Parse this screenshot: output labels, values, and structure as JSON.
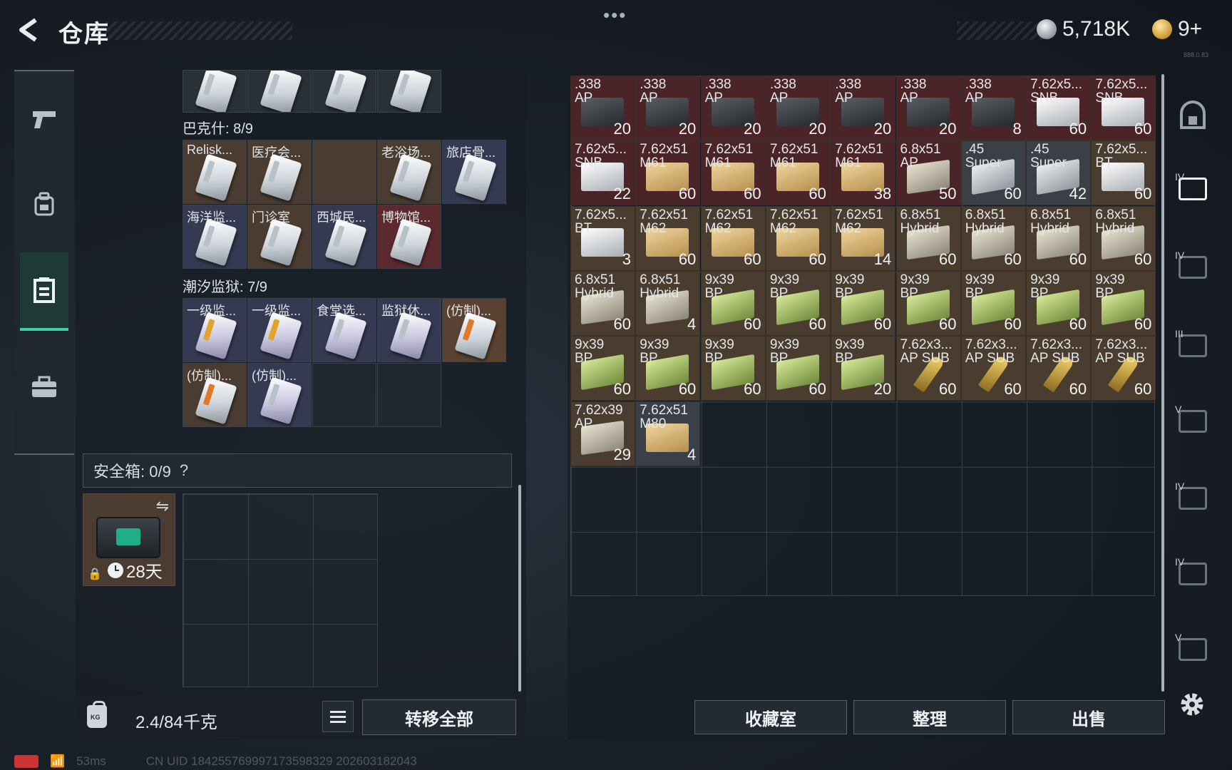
{
  "header": {
    "title": "仓库",
    "more": "•••",
    "currency_silver": "5,718K",
    "currency_gold": "9+",
    "version": "888.0.83"
  },
  "left": {
    "section1_title": "巴克什: 8/9",
    "section1_items": [
      "Relisk...",
      "医疗会...",
      "",
      "老浴场...",
      "旅店骨...",
      "海洋监...",
      "门诊室",
      "西城民...",
      "博物馆..."
    ],
    "section2_title": "潮汐监狱: 7/9",
    "section2_items": [
      "一级监...",
      "一级监...",
      "食堂选...",
      "监狱休...",
      "(仿制)...",
      "(仿制)...",
      "(仿制)..."
    ],
    "safe_title": "安全箱: 0/9",
    "safe_help": "?",
    "safe_timer": "28天",
    "weight": "2.4/84千克",
    "transfer_all": "转移全部"
  },
  "grid": {
    "rows": [
      [
        {
          "n": ".338\nAP",
          "c": "20",
          "t": "red",
          "p": "black"
        },
        {
          "n": ".338\nAP",
          "c": "20",
          "t": "red",
          "p": "black"
        },
        {
          "n": ".338\nAP",
          "c": "20",
          "t": "red",
          "p": "black"
        },
        {
          "n": ".338\nAP",
          "c": "20",
          "t": "red",
          "p": "black"
        },
        {
          "n": ".338\nAP",
          "c": "20",
          "t": "red",
          "p": "black"
        },
        {
          "n": ".338\nAP",
          "c": "20",
          "t": "red",
          "p": "black"
        },
        {
          "n": ".338\nAP",
          "c": "8",
          "t": "red",
          "p": "black"
        },
        {
          "n": "7.62x5...\nSNB",
          "c": "60",
          "t": "red",
          "p": "white"
        },
        {
          "n": "7.62x5...\nSNB",
          "c": "60",
          "t": "red",
          "p": "white"
        }
      ],
      [
        {
          "n": "7.62x5...\nSNB",
          "c": "22",
          "t": "red",
          "p": "white"
        },
        {
          "n": "7.62x51\nM61",
          "c": "60",
          "t": "red",
          "p": "box"
        },
        {
          "n": "7.62x51\nM61",
          "c": "60",
          "t": "red",
          "p": "box"
        },
        {
          "n": "7.62x51\nM61",
          "c": "60",
          "t": "red",
          "p": "box"
        },
        {
          "n": "7.62x51\nM61",
          "c": "38",
          "t": "red",
          "p": "box"
        },
        {
          "n": "6.8x51\nAP",
          "c": "50",
          "t": "red",
          "p": "sand"
        },
        {
          "n": ".45\nSuper",
          "c": "60",
          "t": "gray",
          "p": "silver"
        },
        {
          "n": ".45\nSuper",
          "c": "42",
          "t": "gray",
          "p": "silver"
        },
        {
          "n": "7.62x5...\nBT",
          "c": "60",
          "t": "tan",
          "p": "white"
        }
      ],
      [
        {
          "n": "7.62x5...\nBT",
          "c": "3",
          "t": "tan",
          "p": "white"
        },
        {
          "n": "7.62x51\nM62",
          "c": "60",
          "t": "tan",
          "p": "box"
        },
        {
          "n": "7.62x51\nM62",
          "c": "60",
          "t": "tan",
          "p": "box"
        },
        {
          "n": "7.62x51\nM62",
          "c": "60",
          "t": "tan",
          "p": "box"
        },
        {
          "n": "7.62x51\nM62",
          "c": "14",
          "t": "tan",
          "p": "box"
        },
        {
          "n": "6.8x51\nHybrid",
          "c": "60",
          "t": "tan",
          "p": "sand"
        },
        {
          "n": "6.8x51\nHybrid",
          "c": "60",
          "t": "tan",
          "p": "sand"
        },
        {
          "n": "6.8x51\nHybrid",
          "c": "60",
          "t": "tan",
          "p": "sand"
        },
        {
          "n": "6.8x51\nHybrid",
          "c": "60",
          "t": "tan",
          "p": "sand"
        }
      ],
      [
        {
          "n": "6.8x51\nHybrid",
          "c": "60",
          "t": "tan",
          "p": "sand"
        },
        {
          "n": "6.8x51\nHybrid",
          "c": "4",
          "t": "tan",
          "p": "sand"
        },
        {
          "n": "9x39\nBP",
          "c": "60",
          "t": "tan",
          "p": "green"
        },
        {
          "n": "9x39\nBP",
          "c": "60",
          "t": "tan",
          "p": "green"
        },
        {
          "n": "9x39\nBP",
          "c": "60",
          "t": "tan",
          "p": "green"
        },
        {
          "n": "9x39\nBP",
          "c": "60",
          "t": "tan",
          "p": "green"
        },
        {
          "n": "9x39\nBP",
          "c": "60",
          "t": "tan",
          "p": "green"
        },
        {
          "n": "9x39\nBP",
          "c": "60",
          "t": "tan",
          "p": "green"
        },
        {
          "n": "9x39\nBP",
          "c": "60",
          "t": "tan",
          "p": "green"
        }
      ],
      [
        {
          "n": "9x39\nBP",
          "c": "60",
          "t": "tan",
          "p": "green"
        },
        {
          "n": "9x39\nBP",
          "c": "60",
          "t": "tan",
          "p": "green"
        },
        {
          "n": "9x39\nBP",
          "c": "60",
          "t": "tan",
          "p": "green"
        },
        {
          "n": "9x39\nBP",
          "c": "60",
          "t": "tan",
          "p": "green"
        },
        {
          "n": "9x39\nBP",
          "c": "20",
          "t": "tan",
          "p": "green"
        },
        {
          "n": "7.62x3...\nAP SUB",
          "c": "60",
          "t": "tan",
          "p": "bullet"
        },
        {
          "n": "7.62x3...\nAP SUB",
          "c": "60",
          "t": "tan",
          "p": "bullet"
        },
        {
          "n": "7.62x3...\nAP SUB",
          "c": "60",
          "t": "tan",
          "p": "bullet"
        },
        {
          "n": "7.62x3...\nAP SUB",
          "c": "60",
          "t": "tan",
          "p": "bullet"
        }
      ],
      [
        {
          "n": "7.62x39\nAP",
          "c": "29",
          "t": "tan",
          "p": "sand"
        },
        {
          "n": "7.62x51\nM80",
          "c": "4",
          "t": "gray",
          "p": "box"
        }
      ]
    ]
  },
  "right_buttons": {
    "collection": "收藏室",
    "sort": "整理",
    "sell": "出售"
  },
  "far_rail": {
    "tiers": [
      "",
      "IV",
      "IV",
      "III",
      "V",
      "IV",
      "IV",
      "V"
    ]
  },
  "status": {
    "ping": "53ms",
    "uid": "CN UID 184255769997173598329 202603182043"
  }
}
